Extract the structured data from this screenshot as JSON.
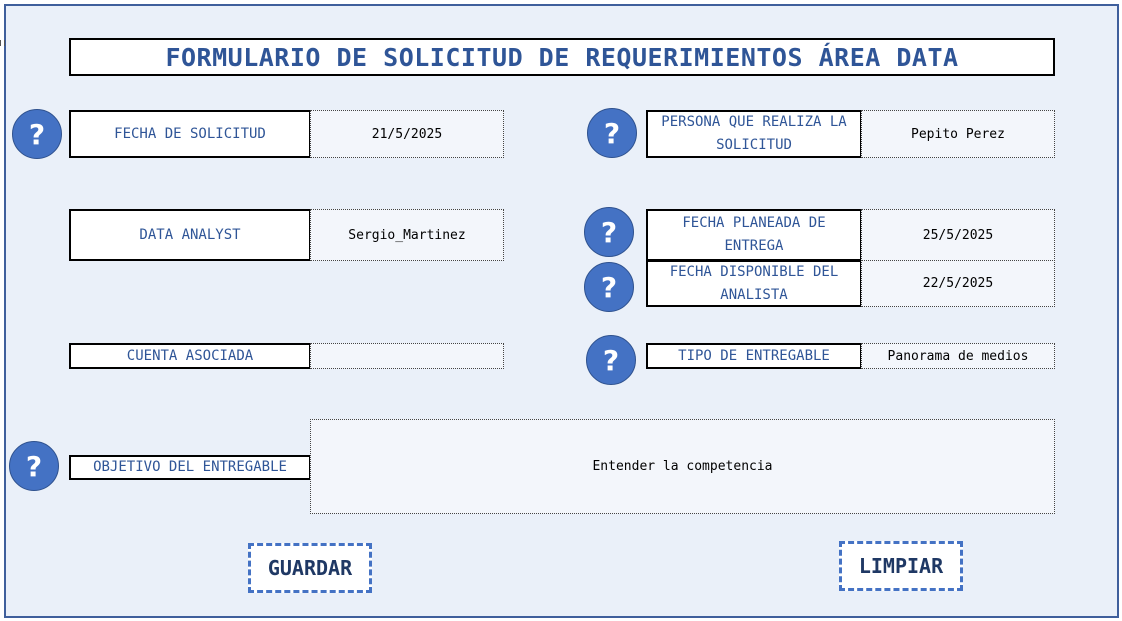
{
  "form": {
    "title": "FORMULARIO DE SOLICITUD DE REQUERIMIENTOS ÁREA DATA",
    "help_icon_glyph": "?",
    "fields": {
      "fecha_solicitud": {
        "label": "FECHA DE SOLICITUD",
        "value": "21/5/2025"
      },
      "persona": {
        "label": "PERSONA QUE REALIZA LA SOLICITUD",
        "value": "Pepito Perez"
      },
      "data_analyst": {
        "label": "DATA ANALYST",
        "value": "Sergio_Martinez"
      },
      "fecha_planeada": {
        "label": "FECHA PLANEADA DE ENTREGA",
        "value": "25/5/2025"
      },
      "fecha_disponible": {
        "label": "FECHA DISPONIBLE DEL ANALISTA",
        "value": "22/5/2025"
      },
      "cuenta": {
        "label": "CUENTA ASOCIADA",
        "value": ""
      },
      "tipo_entregable": {
        "label": "TIPO DE ENTREGABLE",
        "value": "Panorama de medios"
      },
      "objetivo": {
        "label": "OBJETIVO DEL ENTREGABLE",
        "value": "Entender la competencia"
      }
    },
    "buttons": {
      "save": "GUARDAR",
      "clear": "LIMPIAR"
    }
  },
  "colors": {
    "accent": "#4472c4",
    "label_text": "#2f5597",
    "background": "#eaf0f9"
  }
}
